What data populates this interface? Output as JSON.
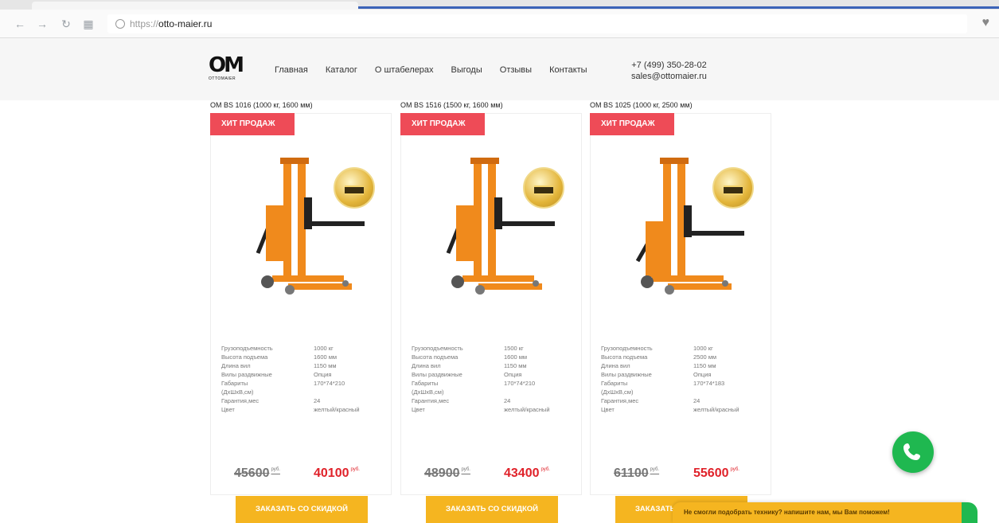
{
  "browser": {
    "url_scheme": "https://",
    "url_host": "otto-maier.ru"
  },
  "header": {
    "logo_text": "OM",
    "logo_sub": "OTTOMAIER",
    "menu": [
      "Главная",
      "Каталог",
      "О штабелерах",
      "Выгоды",
      "Отзывы",
      "Контакты"
    ],
    "phone": "+7 (499) 350-28-02",
    "email": "sales@ottomaier.ru"
  },
  "badge_label": "ХИТ ПРОДАЖ",
  "order_label": "ЗАКАЗАТЬ СО СКИДКОЙ",
  "currency": "руб.",
  "spec_labels": [
    "Грузоподъемность",
    "Высота подъема",
    "Длина вил",
    "Вилы раздвижные",
    "Габариты",
    "(ДхШхВ,см)",
    "Гарантия,мес",
    "Цвет"
  ],
  "products": [
    {
      "title": "OM BS 1016 (1000 кг, 1600 мм)",
      "specs": [
        "1000 кг",
        "1600 мм",
        "1150 мм",
        "Опция",
        "170*74*210",
        "",
        "24",
        "желтый/красный"
      ],
      "old_price": "45600",
      "new_price": "40100"
    },
    {
      "title": "OM BS 1516 (1500 кг, 1600 мм)",
      "specs": [
        "1500 кг",
        "1600 мм",
        "1150 мм",
        "Опция",
        "170*74*210",
        "",
        "24",
        "желтый/красный"
      ],
      "old_price": "48900",
      "new_price": "43400"
    },
    {
      "title": "OM BS 1025 (1000 кг, 2500 мм)",
      "specs": [
        "1000 кг",
        "2500 мм",
        "1150 мм",
        "Опция",
        "170*74*183",
        "",
        "24",
        "желтый/красный"
      ],
      "old_price": "61100",
      "new_price": "55600"
    }
  ],
  "callback_text": "Не смогли подобрать технику? напишите нам, мы Вам поможем!",
  "colors": {
    "badge": "#ee4b57",
    "order_button": "#f5b520",
    "new_price": "#e0222a",
    "call_button": "#1fb850",
    "frame_orange": "#f08a1c"
  }
}
